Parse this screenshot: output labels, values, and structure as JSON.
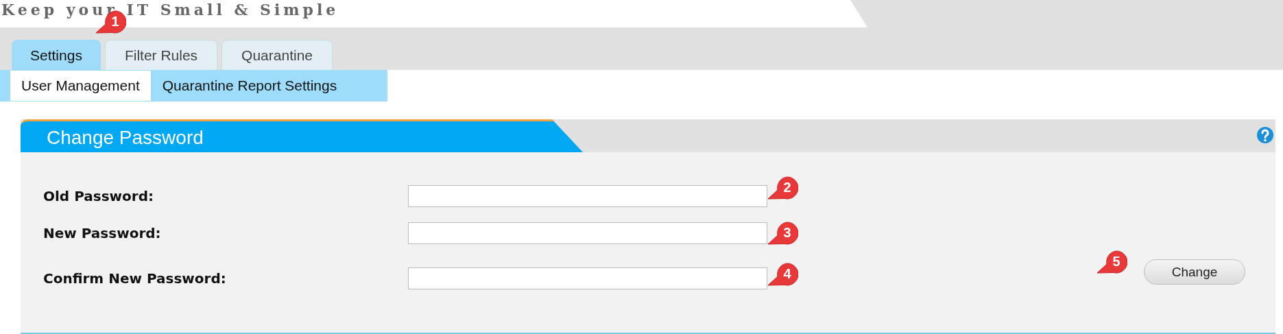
{
  "header": {
    "tagline": "Keep your IT Small & Simple"
  },
  "tabs": [
    {
      "label": "Settings",
      "selected": true
    },
    {
      "label": "Filter Rules",
      "selected": false
    },
    {
      "label": "Quarantine",
      "selected": false
    }
  ],
  "subtabs": [
    {
      "label": "User Management",
      "selected": true
    },
    {
      "label": "Quarantine Report Settings",
      "selected": false
    }
  ],
  "panel": {
    "title": "Change Password",
    "fields": [
      {
        "label": "Old Password:"
      },
      {
        "label": "New Password:"
      },
      {
        "label": "Confirm New Password:"
      }
    ],
    "button": "Change"
  },
  "callouts": [
    {
      "number": "1"
    },
    {
      "number": "2"
    },
    {
      "number": "3"
    },
    {
      "number": "4"
    },
    {
      "number": "5"
    }
  ]
}
